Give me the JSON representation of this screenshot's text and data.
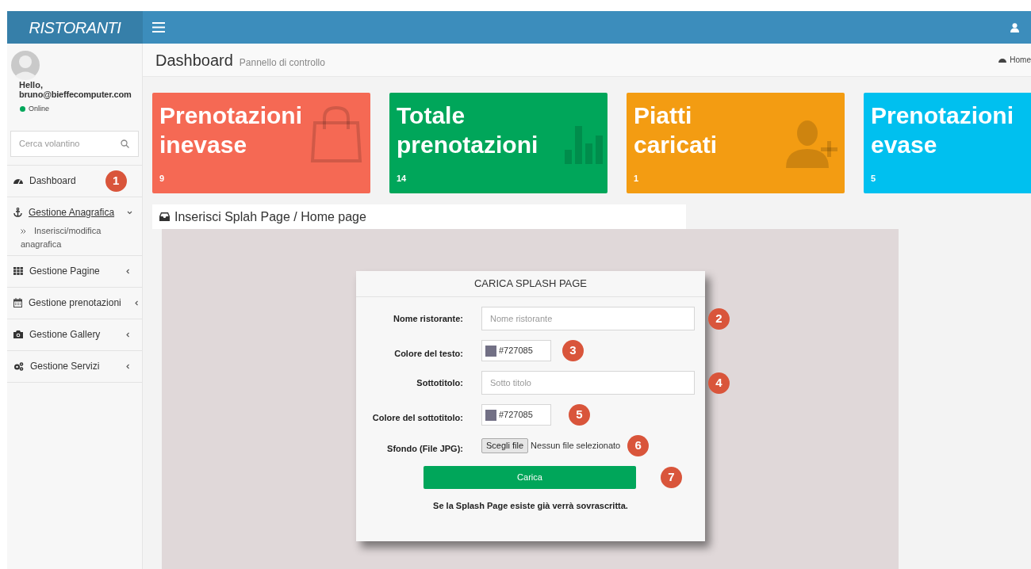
{
  "brand": "RISTORANTI",
  "user": {
    "greeting": "Hello,",
    "email": "bruno@bieffecomputer.com",
    "status": "Online"
  },
  "search": {
    "placeholder": "Cerca volantino"
  },
  "menu": [
    {
      "label": "Dashboard",
      "kind": "link",
      "badge": "1"
    },
    {
      "label": "Gestione Anagrafica",
      "kind": "tree",
      "expanded": true,
      "children": [
        {
          "label": "Inserisci/modifica anagrafica"
        }
      ]
    },
    {
      "label": "Gestione Pagine",
      "kind": "tree",
      "expanded": false
    },
    {
      "label": "Gestione prenotazioni",
      "kind": "tree",
      "expanded": false
    },
    {
      "label": "Gestione Gallery",
      "kind": "tree",
      "expanded": false
    },
    {
      "label": "Gestione Servizi",
      "kind": "tree",
      "expanded": false
    }
  ],
  "page": {
    "title": "Dashboard",
    "subtitle": "Pannello di controllo",
    "breadcrumb": "Home"
  },
  "stats": [
    {
      "title": "Prenotazioni inevase",
      "value": "9",
      "color": "#f56954",
      "kind": "bag"
    },
    {
      "title": "Totale prenotazioni",
      "value": "14",
      "color": "#00a65a",
      "kind": "chart"
    },
    {
      "title": "Piatti caricati",
      "value": "1",
      "color": "#f39c12",
      "kind": "user-add"
    },
    {
      "title": "Prenotazioni evase",
      "value": "5",
      "color": "#00c0ef",
      "kind": "none"
    }
  ],
  "panel": {
    "title": "Inserisci Splah Page / Home page"
  },
  "form": {
    "title": "CARICA SPLASH PAGE",
    "fields": [
      {
        "kind": "text",
        "label": "Nome ristorante:",
        "placeholder": "Nome ristorante",
        "badge": "2"
      },
      {
        "kind": "color",
        "label": "Colore del testo:",
        "value": "#727085",
        "color": "#727085",
        "badge": "3"
      },
      {
        "kind": "text",
        "label": "Sottotitolo:",
        "placeholder": "Sotto titolo",
        "badge": "4"
      },
      {
        "kind": "color",
        "label": "Colore del sottotitolo:",
        "value": "#727085",
        "color": "#727085",
        "badge": "5"
      },
      {
        "kind": "file",
        "label": "Sfondo (File JPG):",
        "button": "Scegli file",
        "status": "Nessun file selezionato",
        "badge": "6"
      }
    ],
    "submit": {
      "label": "Carica",
      "badge": "7"
    },
    "note": "Se la Splash Page esiste già verrà sovrascritta."
  }
}
